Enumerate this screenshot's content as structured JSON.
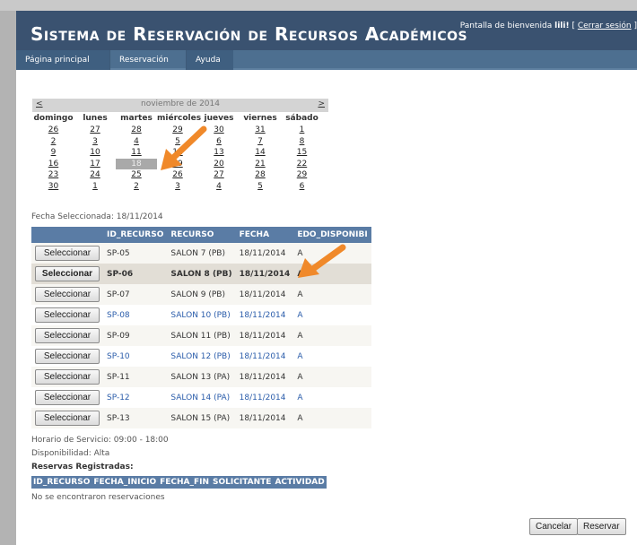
{
  "header": {
    "title": "Sistema de Reservación de Recursos Académicos",
    "welcome_prefix": "Pantalla de bienvenida",
    "user": "lili!",
    "logout_open": "[",
    "logout_label": "Cerrar sesión",
    "logout_close": "]"
  },
  "nav": {
    "items": [
      "Página principal",
      "Reservación",
      "Ayuda"
    ]
  },
  "calendar": {
    "prev": "<",
    "next": ">",
    "month": "noviembre de 2014",
    "weekdays": [
      "domingo",
      "lunes",
      "martes",
      "miércoles",
      "jueves",
      "viernes",
      "sábado"
    ],
    "weeks": [
      [
        "26",
        "27",
        "28",
        "29",
        "30",
        "31",
        "1"
      ],
      [
        "2",
        "3",
        "4",
        "5",
        "6",
        "7",
        "8"
      ],
      [
        "9",
        "10",
        "11",
        "12",
        "13",
        "14",
        "15"
      ],
      [
        "16",
        "17",
        "18",
        "19",
        "20",
        "21",
        "22"
      ],
      [
        "23",
        "24",
        "25",
        "26",
        "27",
        "28",
        "29"
      ],
      [
        "30",
        "1",
        "2",
        "3",
        "4",
        "5",
        "6"
      ]
    ],
    "selected_day": "18"
  },
  "fecha_seleccionada": "Fecha Seleccionada: 18/11/2014",
  "resources": {
    "columns": [
      "",
      "ID_RECURSO",
      "RECURSO",
      "FECHA",
      "EDO_DISPONIBI"
    ],
    "button_label": "Seleccionar",
    "rows": [
      {
        "id": "SP-05",
        "recurso": "SALON 7 (PB)",
        "fecha": "18/11/2014",
        "edo": "A"
      },
      {
        "id": "SP-06",
        "recurso": "SALON 8 (PB)",
        "fecha": "18/11/2014",
        "edo": "A"
      },
      {
        "id": "SP-07",
        "recurso": "SALON 9 (PB)",
        "fecha": "18/11/2014",
        "edo": "A"
      },
      {
        "id": "SP-08",
        "recurso": "SALON 10 (PB)",
        "fecha": "18/11/2014",
        "edo": "A"
      },
      {
        "id": "SP-09",
        "recurso": "SALON 11 (PB)",
        "fecha": "18/11/2014",
        "edo": "A"
      },
      {
        "id": "SP-10",
        "recurso": "SALON 12 (PB)",
        "fecha": "18/11/2014",
        "edo": "A"
      },
      {
        "id": "SP-11",
        "recurso": "SALON 13 (PA)",
        "fecha": "18/11/2014",
        "edo": "A"
      },
      {
        "id": "SP-12",
        "recurso": "SALON 14 (PA)",
        "fecha": "18/11/2014",
        "edo": "A"
      },
      {
        "id": "SP-13",
        "recurso": "SALON 15 (PA)",
        "fecha": "18/11/2014",
        "edo": "A"
      }
    ]
  },
  "info": {
    "horario": "Horario de Servicio: 09:00 - 18:00",
    "disponibilidad": "Disponibilidad: Alta",
    "reservas_label": "Reservas Registradas:"
  },
  "reservations": {
    "columns": [
      "ID_RECURSO",
      "FECHA_INICIO",
      "FECHA_FIN",
      "SOLICITANTE",
      "ACTIVIDAD"
    ],
    "empty": "No se encontraron reservaciones"
  },
  "actions": {
    "cancel": "Cancelar",
    "reserve": "Reservar"
  },
  "colors": {
    "header_bg": "#3a5270",
    "nav_bg": "#4d6f90",
    "grid_header_bg": "#5a7ca5",
    "link_blue": "#2a5caa",
    "arrow_orange": "#f0892a"
  },
  "icons": [
    "pointer-arrow-icon",
    "pointer-arrow-icon"
  ]
}
